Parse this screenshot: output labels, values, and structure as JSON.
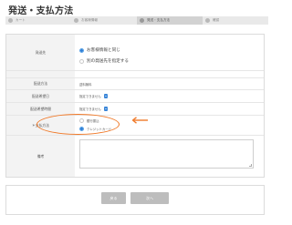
{
  "page": {
    "title": "発送・支払方法"
  },
  "steps": [
    {
      "label": "カート",
      "active": false
    },
    {
      "label": "お客様情報",
      "active": false
    },
    {
      "label": "発送・支払方法",
      "active": true
    },
    {
      "label": "確認",
      "active": false
    }
  ],
  "form": {
    "shipping_address": {
      "label": "発送先",
      "options": [
        {
          "label": "お客様情報と同じ",
          "checked": true
        },
        {
          "label": "別の発送先を指定する",
          "checked": false
        }
      ]
    },
    "shipping_method": {
      "label": "配送方法",
      "value": "送料無料"
    },
    "delivery_date": {
      "label": "配送希望日",
      "value": "指定できません"
    },
    "delivery_time": {
      "label": "配送希望時間",
      "value": "指定できません"
    },
    "payment": {
      "label": "＊支払方法",
      "options": [
        {
          "label": "銀行振込",
          "checked": false
        },
        {
          "label": "クレジットカード",
          "checked": true
        }
      ]
    },
    "notes": {
      "label": "備考",
      "value": ""
    }
  },
  "annotation": {
    "color": "#f07a2a"
  },
  "footer": {
    "back_label": "戻る",
    "next_label": "次へ"
  }
}
